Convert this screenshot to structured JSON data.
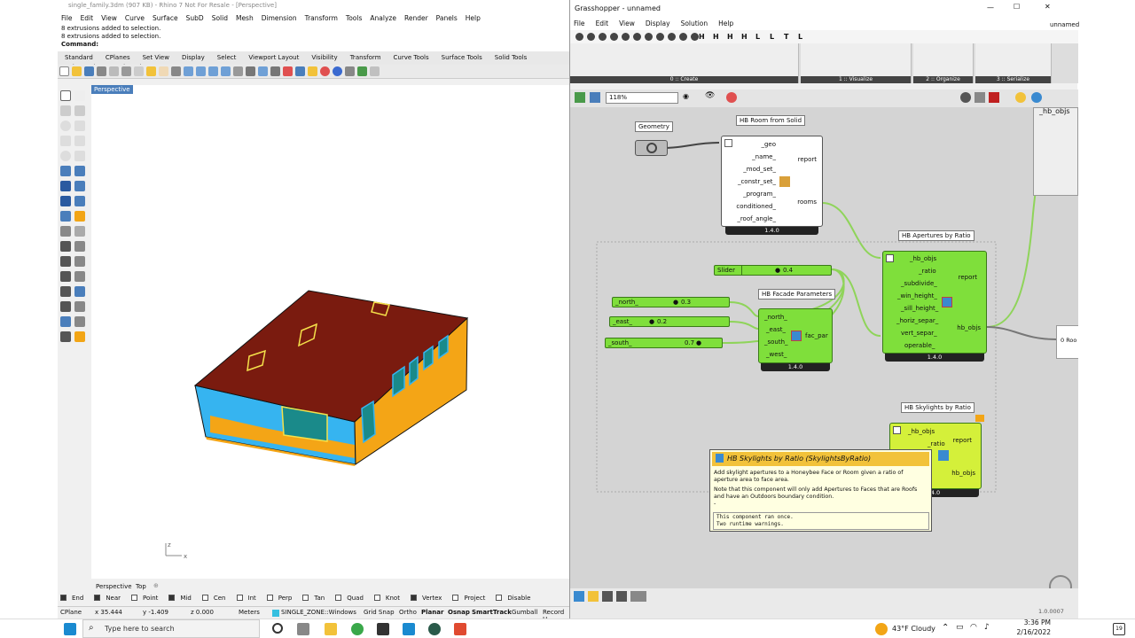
{
  "rhino": {
    "title": "single_family.3dm (907 KB) - Rhino 7 Not For Resale - [Perspective]",
    "menu": [
      "File",
      "Edit",
      "View",
      "Curve",
      "Surface",
      "SubD",
      "Solid",
      "Mesh",
      "Dimension",
      "Transform",
      "Tools",
      "Analyze",
      "Render",
      "Panels",
      "Help"
    ],
    "history": [
      "8 extrusions added to selection.",
      "8 extrusions added to selection.",
      "Command:"
    ],
    "tabs": [
      "Standard",
      "CPlanes",
      "Set View",
      "Display",
      "Select",
      "Viewport Layout",
      "Visibility",
      "Transform",
      "Curve Tools",
      "Surface Tools",
      "Solid Tools",
      "SubD Tools",
      "Mesh Tools"
    ],
    "viewport_label": "Perspective",
    "viewport_tabs": [
      "Perspective",
      "Top"
    ],
    "osnaps": [
      {
        "label": "End",
        "on": true
      },
      {
        "label": "Near",
        "on": true
      },
      {
        "label": "Point",
        "on": false
      },
      {
        "label": "Mid",
        "on": true
      },
      {
        "label": "Cen",
        "on": false
      },
      {
        "label": "Int",
        "on": false
      },
      {
        "label": "Perp",
        "on": false
      },
      {
        "label": "Tan",
        "on": false
      },
      {
        "label": "Quad",
        "on": false
      },
      {
        "label": "Knot",
        "on": false
      },
      {
        "label": "Vertex",
        "on": true
      },
      {
        "label": "Project",
        "on": false
      },
      {
        "label": "Disable",
        "on": false
      }
    ],
    "status": {
      "cplane": "CPlane",
      "x": "x 35.444",
      "y": "y -1.409",
      "z": "z 0.000",
      "units": "Meters",
      "layer": "SINGLE_ZONE::Windows",
      "grid": "Grid Snap",
      "ortho": "Ortho",
      "planar": "Planar",
      "osnap": "Osnap",
      "smarttrack": "SmartTrack",
      "gumball": "Gumball",
      "record": "Record H"
    },
    "axes": {
      "z": "z",
      "x": "x"
    },
    "colors": {
      "roof": "#7a1b0f",
      "wall_blue": "#36b4f0",
      "wall_orange": "#f4a516",
      "window": "#1a8a8a"
    }
  },
  "gh": {
    "title": "Grasshopper - unnamed",
    "doc": "unnamed",
    "menu": [
      "File",
      "Edit",
      "View",
      "Display",
      "Solution",
      "Help"
    ],
    "tabs": [
      "Params",
      "Maths",
      "Sets",
      "Vector",
      "Curve",
      "Surface",
      "Mesh",
      "Intersect",
      "Transform",
      "Display",
      "Kangaroo2",
      "H",
      "H",
      "H",
      "H",
      "L",
      "L",
      "T",
      "L"
    ],
    "groups": [
      "0 :: Create",
      "1 :: Visualize",
      "2 :: Organize",
      "3 :: Serialize"
    ],
    "zoom": "118%",
    "geometry_label": "Geometry",
    "room": {
      "title": "HB Room from Solid",
      "inputs": [
        "_geo",
        "_name_",
        "_mod_set_",
        "_constr_set_",
        "_program_",
        "conditioned_",
        "_roof_angle_"
      ],
      "outputs": [
        "report",
        "rooms"
      ],
      "version": "1.4.0"
    },
    "apertures": {
      "title": "HB Apertures by Ratio",
      "inputs": [
        "_hb_objs",
        "_ratio",
        "_subdivide_",
        "_win_height_",
        "_sill_height_",
        "_horiz_separ_",
        "vert_separ_",
        "operable_"
      ],
      "outputs": [
        "report",
        "hb_objs"
      ],
      "version": "1.4.0"
    },
    "facade": {
      "title": "HB Facade Parameters",
      "inputs": [
        "_north_",
        "_east_",
        "_south_",
        "_west_"
      ],
      "outputs": [
        "fac_par"
      ],
      "version": "1.4.0"
    },
    "skylights": {
      "title": "HB Skylights by Ratio",
      "inputs": [
        "_hb_objs",
        "_ratio"
      ],
      "outputs": [
        "report",
        "hb_objs"
      ],
      "version": "4.0"
    },
    "sliders": [
      {
        "name": "Slider",
        "value": "0.4"
      },
      {
        "name": "_north_",
        "value": "0.3"
      },
      {
        "name": "_east_",
        "value": "0.2"
      },
      {
        "name": "_south_",
        "value": "0.7"
      }
    ],
    "top_param": "_hb_objs",
    "right_param": "0 Roo",
    "tooltip": {
      "title": "HB Skylights by Ratio (SkylightsByRatio)",
      "desc": "Add skylight apertures to a Honeybee Face or Room given a ratio of aperture area to face area.",
      "note": "Note that this component will only add Apertures to Faces that are Roofs and have an Outdoors boundary condition.",
      "dash": "-",
      "msg1": "This component ran once.",
      "msg2": "Two runtime warnings."
    },
    "version": "1.0.0007"
  },
  "taskbar": {
    "search": "Type here to search",
    "weather": "43°F  Cloudy",
    "time": "3:36 PM",
    "date": "2/16/2022",
    "badge": "19"
  }
}
